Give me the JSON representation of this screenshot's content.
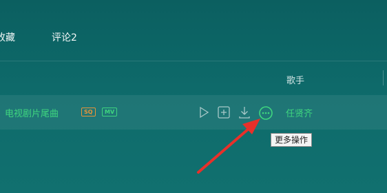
{
  "tabs": {
    "favorites": "收藏",
    "comments": "评论2"
  },
  "table_header": {
    "singer": "歌手"
  },
  "song_row": {
    "title": "》电视剧片尾曲",
    "badges": {
      "sq": "SQ",
      "mv": "MV"
    },
    "singer": "任贤齐"
  },
  "tooltip": {
    "text": "更多操作"
  },
  "colors": {
    "accent_green": "#3fd67f",
    "badge_orange": "#e8953a",
    "arrow_red": "#e8302a"
  },
  "icons": [
    "play-icon",
    "add-icon",
    "download-icon",
    "more-icon"
  ]
}
